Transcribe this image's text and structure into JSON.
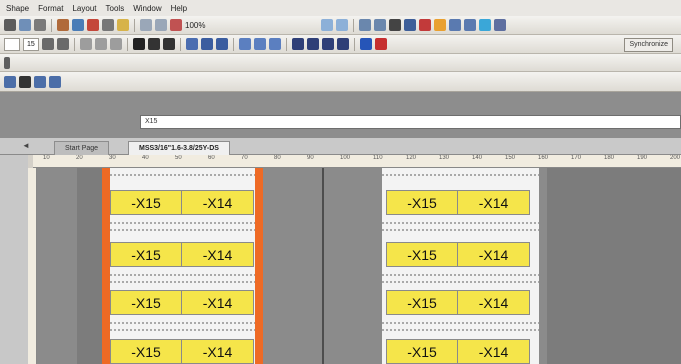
{
  "menu": [
    "Shape",
    "Format",
    "Layout",
    "Tools",
    "Window",
    "Help"
  ],
  "toolbar": {
    "zoom": "100%",
    "font_size": "15",
    "sync_button": "Synchronize"
  },
  "formula": {
    "value": "X15"
  },
  "tabs": {
    "start_page": "Start Page",
    "active_file": "MSS3/16\"1.6-3.8/25Y-DS",
    "nav_arrow": "◄"
  },
  "ruler_marks": [
    "10",
    "20",
    "30",
    "40",
    "50",
    "60",
    "70",
    "80",
    "90",
    "100",
    "110",
    "120",
    "130",
    "140",
    "150",
    "160",
    "170",
    "180",
    "190",
    "200"
  ],
  "left_column": {
    "rows": [
      {
        "a": "-X15",
        "b": "-X14"
      },
      {
        "a": "-X15",
        "b": "-X14"
      },
      {
        "a": "-X15",
        "b": "-X14"
      },
      {
        "a": "-X15",
        "b": "-X14"
      }
    ]
  },
  "right_column": {
    "rows": [
      {
        "a": "-X15",
        "b": "-X14"
      },
      {
        "a": "-X15",
        "b": "-X14"
      },
      {
        "a": "-X15",
        "b": "-X14"
      },
      {
        "a": "-X15",
        "b": "-X14"
      }
    ]
  },
  "colors": {
    "label_fill": "#f5e54a",
    "accent_orange": "#ee6a25",
    "canvas": "#8b8b8b"
  }
}
